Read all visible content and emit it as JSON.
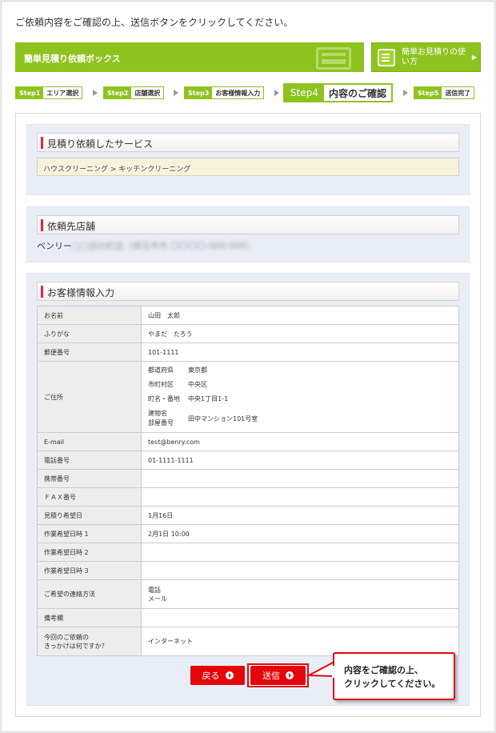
{
  "intro_text": "ご依頼内容をご確認の上、送信ボタンをクリックしてください。",
  "box_title": "簡単見積り依頼ボックス",
  "howto_button": "簡単お見積りの使い方",
  "steps": [
    {
      "no": "Step1",
      "name": "エリア選択"
    },
    {
      "no": "Step2",
      "name": "店舗選択"
    },
    {
      "no": "Step3",
      "name": "お客様情報入力"
    },
    {
      "no": "Step4",
      "name": "内容のご確認"
    },
    {
      "no": "Step5",
      "name": "送信完了"
    }
  ],
  "service_section": {
    "heading": "見積り依頼したサービス",
    "value": "ハウスクリーニング > キッチンクリーニング"
  },
  "shop_section": {
    "heading": "依頼先店舗",
    "shop_name": "ベンリー",
    "shop_detail_blurred": "□□店の町店（埼玉市市 〇〇〇〇-000-000）"
  },
  "customer_section": {
    "heading": "お客様情報入力",
    "rows": [
      {
        "label": "お名前",
        "value": "山田　太郎"
      },
      {
        "label": "ふりがな",
        "value": "やまだ　たろう"
      },
      {
        "label": "郵便番号",
        "value": "101-1111"
      },
      {
        "label": "ご住所",
        "value": ""
      },
      {
        "label": "E-mail",
        "value": "test@benry.com"
      },
      {
        "label": "電話番号",
        "value": "01-1111-1111"
      },
      {
        "label": "携帯番号",
        "value": ""
      },
      {
        "label": "ＦＡＸ番号",
        "value": ""
      },
      {
        "label": "見積り希望日",
        "value": "1月16日"
      },
      {
        "label": "作業希望日時 1",
        "value": "2月1日 10:00"
      },
      {
        "label": "作業希望日時 2",
        "value": ""
      },
      {
        "label": "作業希望日時 3",
        "value": ""
      },
      {
        "label": "ご希望の連絡方法",
        "value": ""
      },
      {
        "label": "備考欄",
        "value": ""
      },
      {
        "label": "今回のご依頼の",
        "label2": "きっかけは何ですか？",
        "value": "インターネット"
      }
    ],
    "address": [
      {
        "label": "都道府県",
        "value": "東京都"
      },
      {
        "label": "市町村区",
        "value": "中央区"
      },
      {
        "label": "町名・番地",
        "value": "中央1丁目1-1"
      },
      {
        "label": "建物名",
        "label2": "部屋番号",
        "value": "田中マンション101号室"
      }
    ],
    "contact_methods": [
      "電話",
      "メール"
    ]
  },
  "buttons": {
    "back": "戻る",
    "send": "送信"
  },
  "callout": {
    "line1": "内容をご確認の上、",
    "line2": "クリックしてください。"
  },
  "colors": {
    "brand_green": "#8ec31f",
    "accent_red": "#e4060b",
    "section_bg": "#e9edf6"
  }
}
